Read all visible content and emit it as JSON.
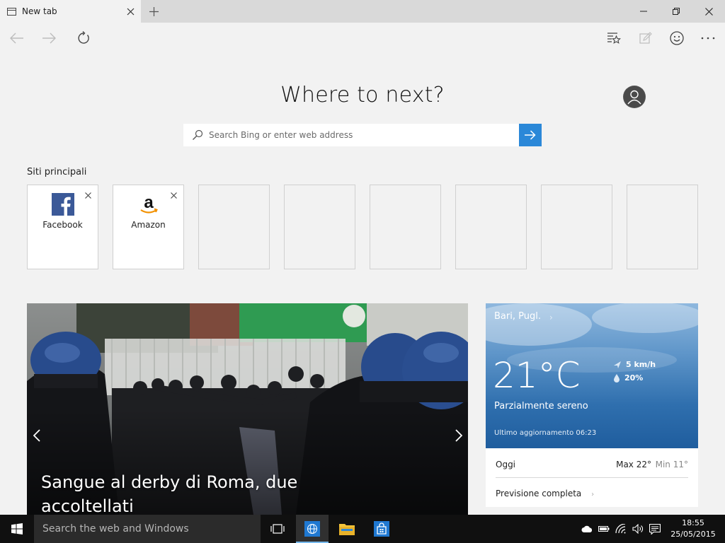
{
  "tab": {
    "title": "New tab"
  },
  "window_controls": {
    "minimize": "─",
    "restore": "❐",
    "close": "✕"
  },
  "toolbar": {
    "back_icon": "arrow-left-icon",
    "forward_icon": "arrow-right-icon",
    "refresh_icon": "refresh-icon",
    "hub_icon": "hub-star-icon",
    "note_icon": "web-note-icon",
    "feedback_icon": "smiley-icon",
    "more_icon": "more-dots-icon",
    "more_label": "···"
  },
  "main": {
    "heading": "Where to next?",
    "search_placeholder": "Search Bing or enter web address"
  },
  "top_sites": {
    "label": "Siti principali",
    "tiles": [
      {
        "label": "Facebook",
        "icon": "facebook-icon",
        "close": "✕"
      },
      {
        "label": "Amazon",
        "icon": "amazon-icon",
        "close": "✕"
      }
    ]
  },
  "news": {
    "headline": "Sangue al derby di Roma, due accoltellati"
  },
  "weather": {
    "location": "Bari, Pugl.",
    "chevron": "›",
    "temperature": "21°C",
    "wind": "5 km/h",
    "rain": "20%",
    "condition": "Parzialmente sereno",
    "updated": "Ultimo aggiornamento 06:23",
    "today_label": "Oggi",
    "today_max": "Max 22°",
    "today_min": "Min 11°",
    "forecast_label": "Previsione completa",
    "forecast_chevron": "›"
  },
  "taskbar": {
    "search_text": "Search the web and Windows",
    "time": "18:55",
    "date": "25/05/2015"
  },
  "colors": {
    "accent": "#2b88d8",
    "taskbar": "#101010",
    "page_bg": "#f2f2f2"
  }
}
